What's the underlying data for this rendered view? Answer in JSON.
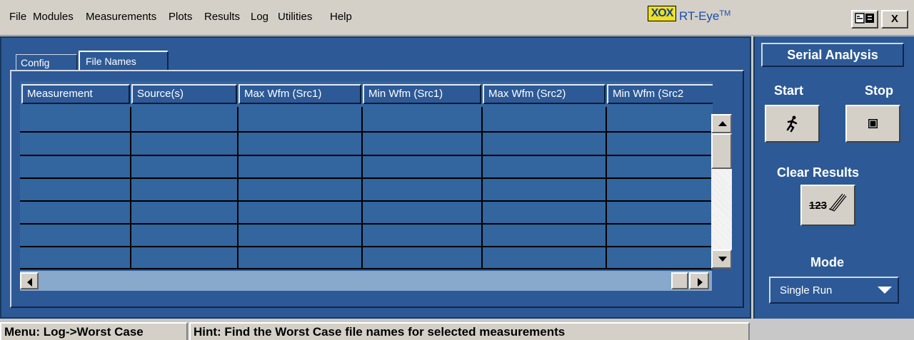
{
  "menubar": {
    "items": [
      "File",
      "Modules",
      "Measurements",
      "Plots",
      "Results",
      "Log",
      "Utilities",
      "Help"
    ],
    "logo_text": "XOX",
    "app_title": "RT-Eye",
    "app_title_tm": "TM",
    "close_label": "X"
  },
  "tabs": [
    {
      "label": "Config",
      "active": false
    },
    {
      "label": "File Names",
      "active": true
    }
  ],
  "table": {
    "columns": [
      "Measurement",
      "Source(s)",
      "Max Wfm (Src1)",
      "Min Wfm (Src1)",
      "Max Wfm (Src2)",
      "Min Wfm (Src2"
    ],
    "rows": [
      [
        "",
        "",
        "",
        "",
        "",
        ""
      ],
      [
        "",
        "",
        "",
        "",
        "",
        ""
      ],
      [
        "",
        "",
        "",
        "",
        "",
        ""
      ],
      [
        "",
        "",
        "",
        "",
        "",
        ""
      ],
      [
        "",
        "",
        "",
        "",
        "",
        ""
      ],
      [
        "",
        "",
        "",
        "",
        "",
        ""
      ],
      [
        "",
        "",
        "",
        "",
        "",
        ""
      ]
    ]
  },
  "side_panel": {
    "title": "Serial Analysis",
    "start_label": "Start",
    "stop_label": "Stop",
    "clear_label": "Clear Results",
    "clear_icon_text": "123",
    "mode_label": "Mode",
    "mode_value": "Single Run"
  },
  "status": {
    "menu": "Menu: Log->Worst Case",
    "hint": "Hint: Find the Worst Case file names for selected measurements"
  },
  "colors": {
    "panel_blue": "#2d5a96",
    "table_cell_blue": "#33659f",
    "title_blue": "#1850b0",
    "logo_yellow": "#f0e020"
  }
}
